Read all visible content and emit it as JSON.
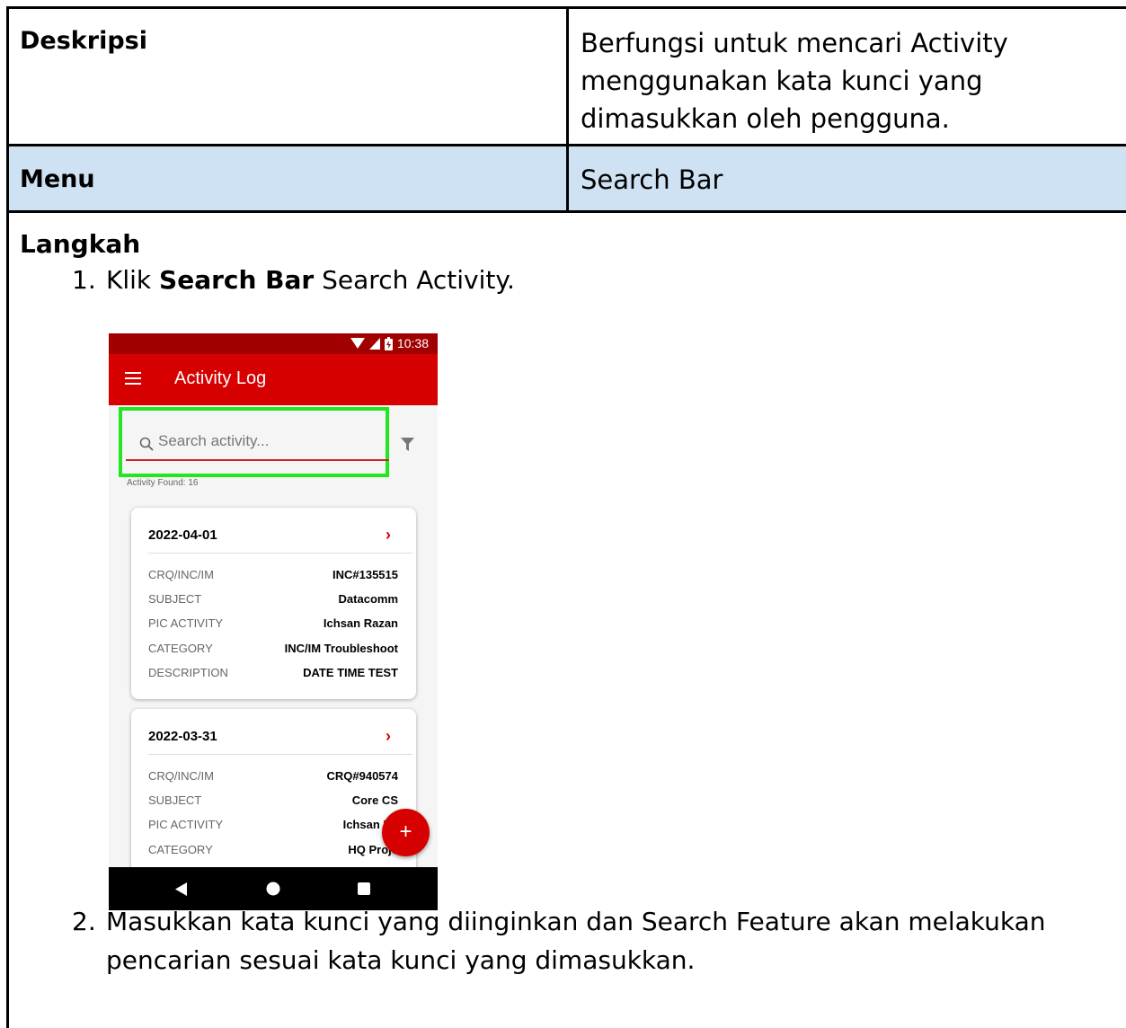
{
  "table": {
    "row1": {
      "label": "Deskripsi",
      "value": "Berfungsi untuk mencari Activity menggunakan kata kunci yang dimasukkan oleh pengguna."
    },
    "row2": {
      "label": "Menu",
      "value": "Search Bar"
    }
  },
  "steps": {
    "heading": "Langkah",
    "step1": {
      "num": "1.",
      "pre": "Klik ",
      "bold": "Search Bar",
      "post": " Search Activity."
    },
    "step2": {
      "num": "2.",
      "text": "Masukkan kata kunci yang diinginkan dan Search Feature akan melakukan pencarian sesuai kata kunci yang dimasukkan."
    }
  },
  "phone": {
    "time": "10:38",
    "title": "Activity Log",
    "search_placeholder": "Search activity...",
    "found": "Activity Found: 16",
    "cards": [
      {
        "date": "2022-04-01",
        "rows": [
          {
            "k": "CRQ/INC/IM",
            "v": "INC#135515"
          },
          {
            "k": "SUBJECT",
            "v": "Datacomm"
          },
          {
            "k": "PIC ACTIVITY",
            "v": "Ichsan Razan"
          },
          {
            "k": "CATEGORY",
            "v": "INC/IM Troubleshoot"
          },
          {
            "k": "DESCRIPTION",
            "v": "DATE TIME TEST"
          }
        ]
      },
      {
        "date": "2022-03-31",
        "rows": [
          {
            "k": "CRQ/INC/IM",
            "v": "CRQ#940574"
          },
          {
            "k": "SUBJECT",
            "v": "Core CS"
          },
          {
            "k": "PIC ACTIVITY",
            "v": "Ichsan Ra"
          },
          {
            "k": "CATEGORY",
            "v": "HQ Proje"
          }
        ]
      }
    ],
    "fab_icon": "plus-icon",
    "colors": {
      "appbar": "#d70000",
      "statusbar": "#a10000",
      "highlight": "#22e622"
    }
  }
}
